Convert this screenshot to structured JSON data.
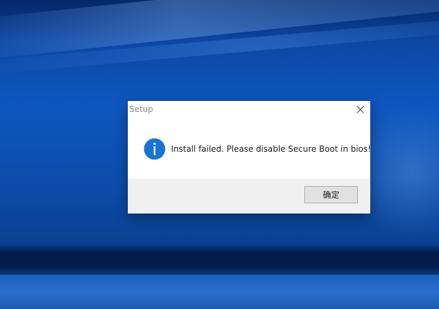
{
  "dialog": {
    "title": "Setup",
    "message": "Install failed. Please disable Secure Boot in bios!",
    "ok_label": "确定",
    "icon": "info-icon",
    "close_icon": "close-icon"
  },
  "colors": {
    "info_icon_blue": "#1976d2",
    "desktop_blue": "#0e56bf",
    "footer_gray": "#f0f0f0",
    "button_gray": "#e1e1e1"
  }
}
